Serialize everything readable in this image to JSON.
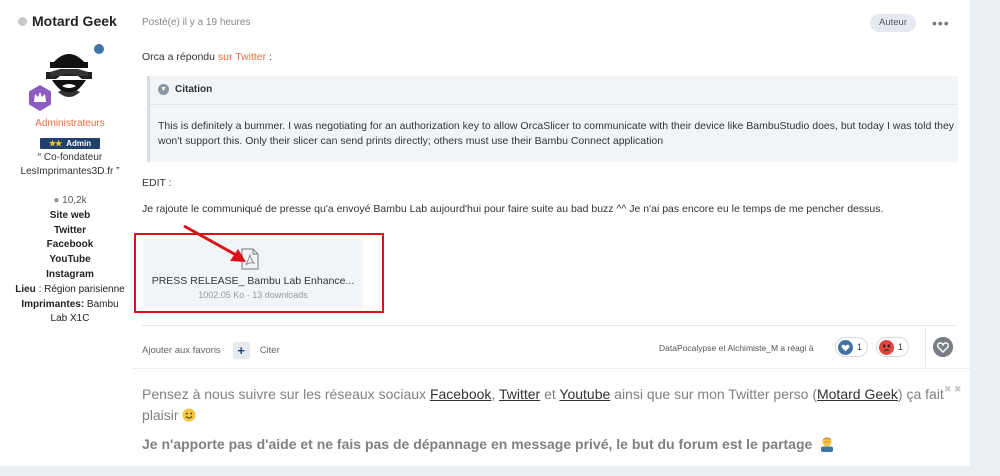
{
  "author": {
    "name": "Motard Geek",
    "group": "Administrateurs",
    "admin_badge": "Admin",
    "admin_stars": "★★",
    "title_line1": "“ Co-fondateur",
    "title_line2": "LesImprimantes3D.fr ”",
    "post_count": "10,2k",
    "links": [
      "Site web",
      "Twitter",
      "Facebook",
      "YouTube",
      "Instagram"
    ],
    "location_label": "Lieu",
    "location_value": " : Région parisienne",
    "printers_label": "Imprimantes:",
    "printers_value": " Bambu",
    "printers_value2": "Lab X1C"
  },
  "post": {
    "posted": "Posté(e) il y a 19 heures",
    "author_badge": "Auteur",
    "more": "•••",
    "reply_prefix": "Orca a répondu ",
    "reply_link": "sur Twitter",
    "reply_suffix": " :",
    "quote_title": "Citation",
    "quote_text": "This is definitely a bummer. I was negotiating for an authorization key to allow OrcaSlicer to communicate with their device like BambuStudio does, but today I was told they won't support this. Only their slicer can send prints directly; others must use their Bambu Connect application",
    "edit_label": "EDIT :",
    "edit_text": "Je rajoute le communiqué de presse qu'a envoyé Bambu Lab aujourd'hui pour faire suite au bad buzz ^^ Je n'ai pas encore eu le temps de me pencher dessus.",
    "attachment_name": "PRESS RELEASE_ Bambu Lab Enhance...",
    "attachment_meta": "1002.05 Ko · 13 downloads"
  },
  "actions": {
    "favorite": "Ajouter aux favoris",
    "add": "+",
    "quote": "Citer",
    "reactors": "DataPocalypse et Alchimiste_M a réagi à",
    "reactions": [
      {
        "icon": "heart-icon",
        "count": "1",
        "color": "#3f73a6"
      },
      {
        "icon": "angry-face-icon",
        "count": "1",
        "color": "#e0463c"
      }
    ]
  },
  "signature": {
    "line1_a": "Pensez à nous suivre sur les réseaux sociaux ",
    "facebook": "Facebook",
    "sep1": ", ",
    "twitter": "Twitter",
    "sep2": " et ",
    "youtube": "Youtube",
    "line1_b": " ainsi que sur mon Twitter perso (",
    "motard": "Motard Geek",
    "line1_c": ") ça fait plaisir ",
    "line2": "Je n'apporte pas d'aide et ne fais pas de dépannage en message privé, le but du forum est le partage",
    "close": "✖ ✖"
  },
  "colors": {
    "accent": "#e5703c",
    "brand": "#21406b",
    "highlight_frame": "#d8141a"
  }
}
